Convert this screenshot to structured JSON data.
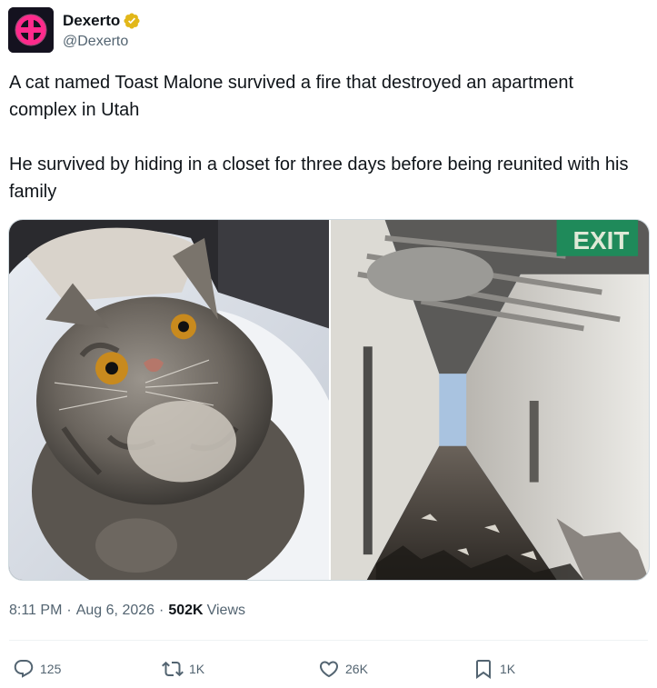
{
  "author": {
    "display_name": "Dexerto",
    "handle": "@Dexerto",
    "verified": true,
    "avatar_icon": "dexerto-logo-icon"
  },
  "tweet": {
    "paragraphs": [
      "A cat named Toast Malone survived a fire that destroyed an apartment complex in Utah",
      "He survived by hiding in a closet for three days before being reunited with his family"
    ]
  },
  "media": {
    "images": [
      {
        "subject": "tabby-cat-photo"
      },
      {
        "subject": "burned-hallway-photo",
        "sign_text": "EXIT"
      }
    ]
  },
  "meta": {
    "time": "8:11 PM",
    "date": "Aug 6, 2026",
    "views_count": "502K",
    "views_label": "Views"
  },
  "actions": {
    "reply_count": "125",
    "retweet_count": "1K",
    "like_count": "26K",
    "bookmark_count": "1K"
  },
  "colors": {
    "text_primary": "#0f1419",
    "text_secondary": "#536471",
    "verified_gold": "#e2b719",
    "avatar_accent": "#ff2a8c"
  }
}
